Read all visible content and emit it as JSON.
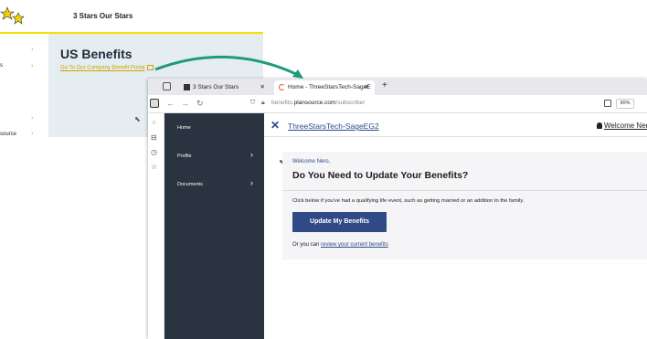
{
  "background_window": {
    "site_title": "3 Stars Our Stars",
    "heading": "US Benefits",
    "portal_link": "Go To Our Company Benefit Portal",
    "sidebar_fragments": [
      "s",
      "source"
    ]
  },
  "browser": {
    "tabs": [
      {
        "label": "3 Stars Our Stars"
      },
      {
        "label": "Home - ThreeStarsTech-SageE"
      }
    ],
    "url_prefix": "benefits.",
    "url_domain": "plansource.com",
    "url_path": "/subscriber",
    "zoom": "90%"
  },
  "app": {
    "nav": [
      {
        "label": "Home"
      },
      {
        "label": "Profile"
      },
      {
        "label": "Documents"
      }
    ],
    "company_name": "ThreeStarsTech-SageEG2",
    "user_name": "Welcome Nero"
  },
  "card": {
    "welcome": "Welcome Nero,",
    "title": "Do You Need to Update Your Benefits?",
    "description": "Click below if you've had a qualifying life event, such as getting married or an addition to the family.",
    "button_label": "Update My Benefits",
    "or_text": "Or you can ",
    "review_link": "review your current benefits"
  },
  "colors": {
    "brand_blue": "#2f4a86",
    "nav_bg": "#2a3340",
    "accent_yellow": "#f2e200",
    "arrow_green": "#1e9b7a"
  }
}
